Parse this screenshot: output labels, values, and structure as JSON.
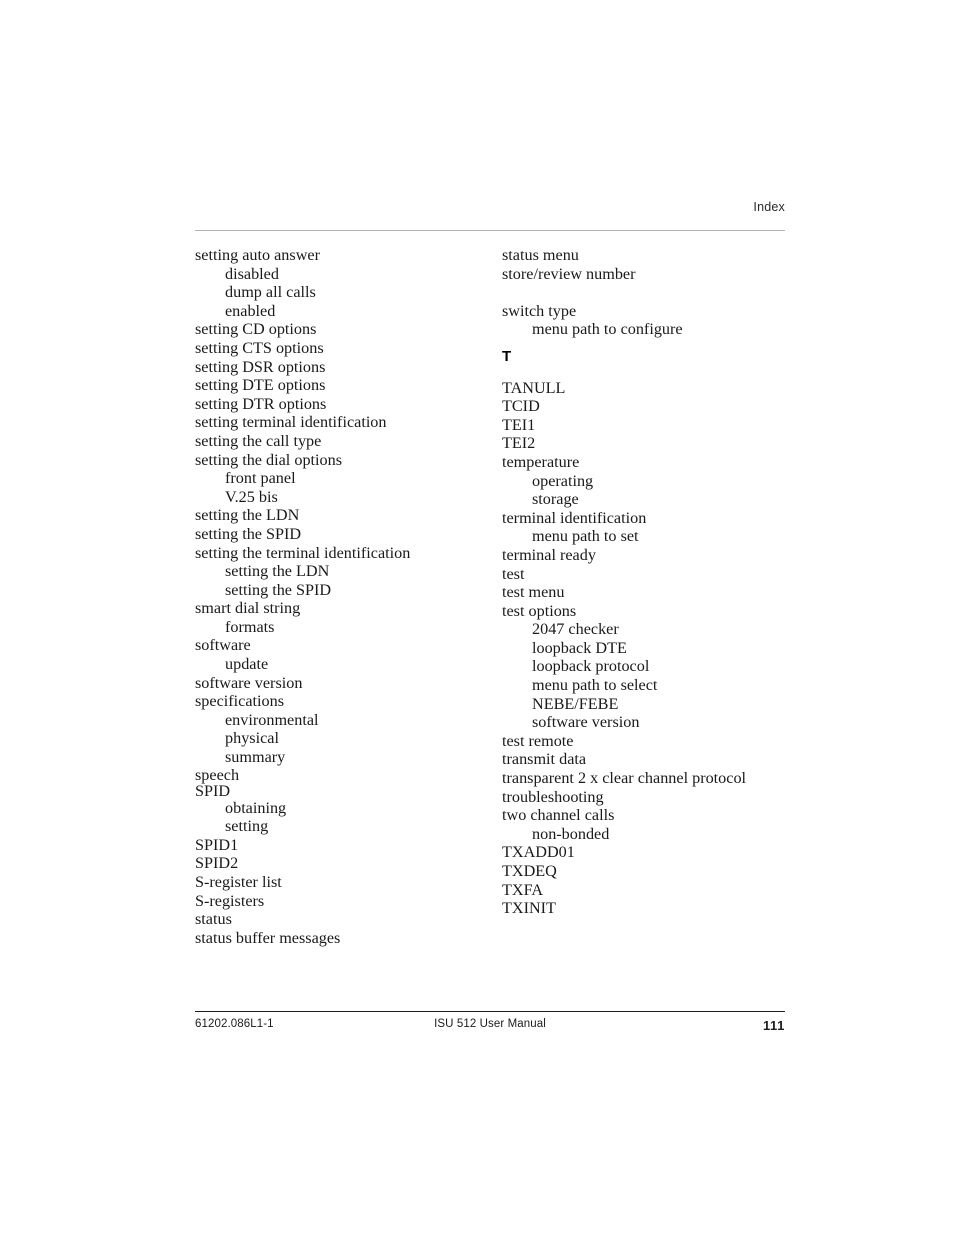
{
  "header": {
    "title": "Index"
  },
  "footer": {
    "doc_number": "61202.086L1-1",
    "manual_title": "ISU 512 User Manual",
    "page_number": "111"
  },
  "colors": {
    "header_rule": "#b3b3b3",
    "footer_rule": "#1c1c1c",
    "text": "#1a1a1a"
  },
  "index": {
    "left_column": [
      {
        "level": 1,
        "text": "setting auto answer"
      },
      {
        "level": 2,
        "text": "disabled"
      },
      {
        "level": 2,
        "text": "dump all calls"
      },
      {
        "level": 2,
        "text": "enabled"
      },
      {
        "level": 1,
        "text": "setting CD options"
      },
      {
        "level": 1,
        "text": "setting CTS options"
      },
      {
        "level": 1,
        "text": "setting DSR options"
      },
      {
        "level": 1,
        "text": "setting DTE options"
      },
      {
        "level": 1,
        "text": "setting DTR options"
      },
      {
        "level": 1,
        "text": "setting terminal identification"
      },
      {
        "level": 1,
        "text": "setting the call type"
      },
      {
        "level": 1,
        "text": "setting the dial options"
      },
      {
        "level": 2,
        "text": "front panel"
      },
      {
        "level": 2,
        "text": "V.25 bis"
      },
      {
        "level": 1,
        "text": "setting the LDN"
      },
      {
        "level": 1,
        "text": "setting the SPID"
      },
      {
        "level": 1,
        "text": "setting the terminal identification"
      },
      {
        "level": 2,
        "text": "setting the LDN"
      },
      {
        "level": 2,
        "text": "setting the SPID"
      },
      {
        "level": 1,
        "text": "smart dial string"
      },
      {
        "level": 2,
        "text": "formats"
      },
      {
        "level": 1,
        "text": "software"
      },
      {
        "level": 2,
        "text": "update"
      },
      {
        "level": 1,
        "text": "software version"
      },
      {
        "level": 1,
        "text": "specifications"
      },
      {
        "level": 2,
        "text": "environmental"
      },
      {
        "level": 2,
        "text": "physical"
      },
      {
        "level": 2,
        "text": "summary"
      },
      {
        "level": 1,
        "text": "speech",
        "tight": true
      },
      {
        "level": 1,
        "text": "SPID",
        "tight": true
      },
      {
        "level": 2,
        "text": "obtaining"
      },
      {
        "level": 2,
        "text": "setting"
      },
      {
        "level": 1,
        "text": "SPID1"
      },
      {
        "level": 1,
        "text": "SPID2"
      },
      {
        "level": 1,
        "text": "S-register list"
      },
      {
        "level": 1,
        "text": "S-registers"
      },
      {
        "level": 1,
        "text": "status"
      },
      {
        "level": 1,
        "text": "status buffer messages"
      }
    ],
    "right_column": [
      {
        "level": 1,
        "text": "status menu"
      },
      {
        "level": 1,
        "text": "store/review number"
      },
      {
        "spacer": true
      },
      {
        "level": 1,
        "text": "switch type"
      },
      {
        "level": 2,
        "text": "menu path to configure"
      },
      {
        "section_letter": "T"
      },
      {
        "level": 1,
        "text": "TANULL"
      },
      {
        "level": 1,
        "text": "TCID"
      },
      {
        "level": 1,
        "text": "TEI1"
      },
      {
        "level": 1,
        "text": "TEI2"
      },
      {
        "level": 1,
        "text": "temperature"
      },
      {
        "level": 2,
        "text": "operating"
      },
      {
        "level": 2,
        "text": "storage"
      },
      {
        "level": 1,
        "text": "terminal identification"
      },
      {
        "level": 2,
        "text": "menu path to set"
      },
      {
        "level": 1,
        "text": "terminal ready"
      },
      {
        "level": 1,
        "text": "test"
      },
      {
        "level": 1,
        "text": "test menu"
      },
      {
        "level": 1,
        "text": "test options"
      },
      {
        "level": 2,
        "text": "2047 checker"
      },
      {
        "level": 2,
        "text": "loopback DTE"
      },
      {
        "level": 2,
        "text": "loopback protocol"
      },
      {
        "level": 2,
        "text": "menu path to select"
      },
      {
        "level": 2,
        "text": "NEBE/FEBE"
      },
      {
        "level": 2,
        "text": "software version"
      },
      {
        "level": 1,
        "text": "test remote"
      },
      {
        "level": 1,
        "text": "transmit data"
      },
      {
        "level": 1,
        "text": "transparent 2 x clear channel protocol"
      },
      {
        "level": 1,
        "text": "troubleshooting"
      },
      {
        "level": 1,
        "text": "two channel calls"
      },
      {
        "level": 2,
        "text": "non-bonded"
      },
      {
        "level": 1,
        "text": "TXADD01"
      },
      {
        "level": 1,
        "text": "TXDEQ"
      },
      {
        "level": 1,
        "text": "TXFA"
      },
      {
        "level": 1,
        "text": "TXINIT"
      }
    ]
  }
}
